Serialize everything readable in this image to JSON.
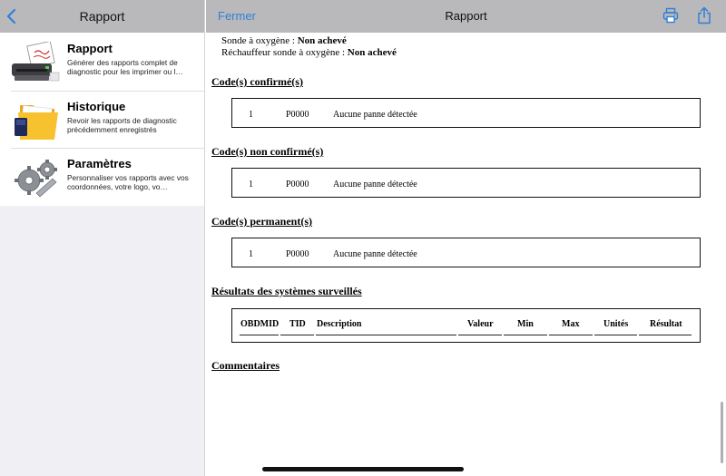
{
  "sidebar": {
    "title": "Rapport",
    "items": [
      {
        "name": "Rapport",
        "desc": "Générer des rapports complet de diagnostic pour les imprimer ou l…",
        "icon": "printer-report-icon"
      },
      {
        "name": "Historique",
        "desc": "Revoir les rapports de diagnostic précédemment enregistrés",
        "icon": "folder-history-icon"
      },
      {
        "name": "Paramètres",
        "desc": "Personnaliser vos rapports avec vos coordonnées, votre logo, vo…",
        "icon": "gears-settings-icon"
      }
    ]
  },
  "header": {
    "close_label": "Fermer",
    "title": "Rapport"
  },
  "report": {
    "line1_label": "Sonde à oxygène : ",
    "line1_value": "Non achevé",
    "line2_label": "Réchauffeur sonde à oxygène : ",
    "line2_value": "Non achevé",
    "confirmed": {
      "title": "Code(s) confirmé(s)",
      "num": "1",
      "code": "P0000",
      "desc": "Aucune panne détectée"
    },
    "unconfirmed": {
      "title": "Code(s) non confirmé(s)",
      "num": "1",
      "code": "P0000",
      "desc": "Aucune panne détectée"
    },
    "permanent": {
      "title": "Code(s) permanent(s)",
      "num": "1",
      "code": "P0000",
      "desc": "Aucune panne détectée"
    },
    "monitored": {
      "title": "Résultats des systèmes surveillés",
      "columns": [
        "OBDMID",
        "TID",
        "Description",
        "Valeur",
        "Min",
        "Max",
        "Unités",
        "Résultat"
      ]
    },
    "comments_title": "Commentaires"
  },
  "colors": {
    "accent": "#2f7fd8",
    "header_bg": "#b9b9bb"
  }
}
